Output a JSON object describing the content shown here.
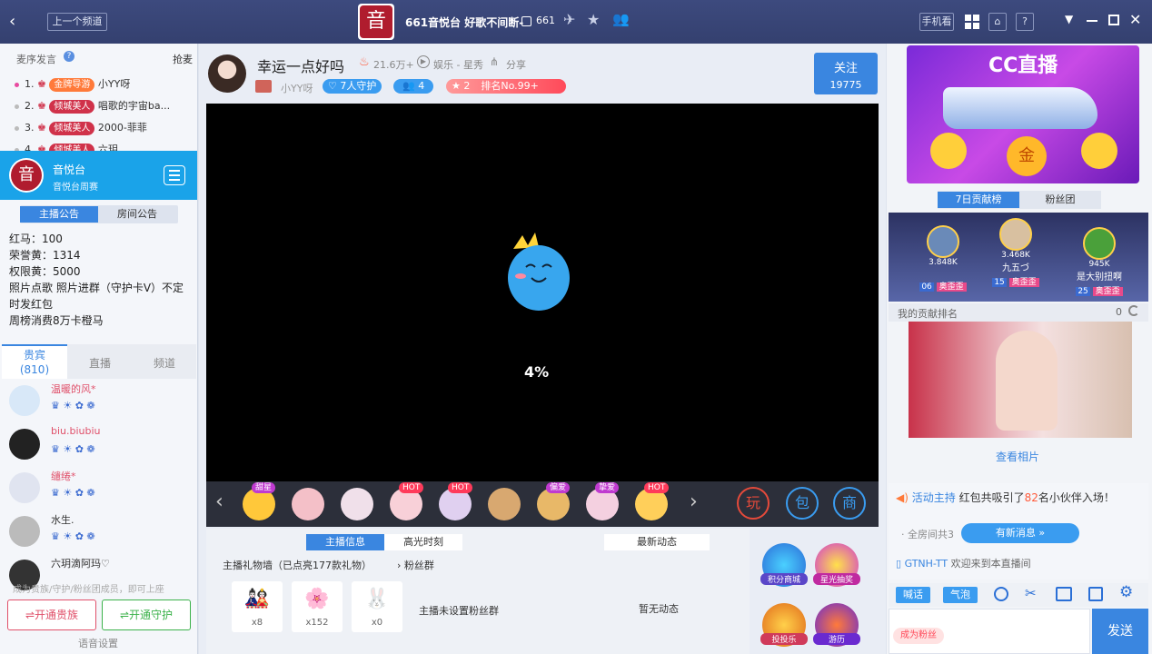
{
  "titlebar": {
    "back_icon": "chevron-left-icon",
    "prev_channel": "上一个频道",
    "logo_glyph": "音",
    "channel_name": "661音悦台 好歌不间断-",
    "channel_id": "661",
    "mobile_label": "手机看"
  },
  "left": {
    "rank_header": "麦序发言",
    "grab_label": "抢麦",
    "rank": [
      {
        "num": "1.",
        "tag": "金牌导游",
        "name": "小YY呀"
      },
      {
        "num": "2.",
        "tag": "倾城美人",
        "name": "唱歌的宇宙ba..."
      },
      {
        "num": "3.",
        "tag": "倾城美人",
        "name": "2000-菲菲"
      },
      {
        "num": "4.",
        "tag": "倾城美人",
        "name": "六玥"
      }
    ],
    "channel_logo": "音",
    "channel_title": "音悦台",
    "channel_sub": "音悦台周赛",
    "tabs": [
      "主播公告",
      "房间公告"
    ],
    "notice": [
      "红马：100",
      "荣誉黄：1314",
      "权限黄：5000",
      "照片点歌  照片进群（守护卡V）不定时发红包",
      "周榜消费8万卡橙马"
    ],
    "user_tabs": [
      "贵宾",
      "直播",
      "频道"
    ],
    "vip_count": "(810)",
    "users": [
      {
        "name": "温暖的风*",
        "color": "#e0506a"
      },
      {
        "name": "biu.biubiu",
        "color": "#e0506a"
      },
      {
        "name": "缱绻*",
        "color": "#e0506a"
      },
      {
        "name": "水生.",
        "color": "#333"
      },
      {
        "name": "六玥滴阿玛♡",
        "color": "#333"
      }
    ],
    "footer_hint": "成为贵族/守护/粉丝团成员，即可上座",
    "btn_noble": "开通贵族",
    "btn_guard": "开通守护",
    "voice_settings": "语音设置"
  },
  "anchor": {
    "name": "幸运一点好吗",
    "heat": "21.6万+",
    "category": "娱乐 - 星秀",
    "share": "分享",
    "sub_name": "小YY呀",
    "guards": "7人守护",
    "fans": "4",
    "rank_num": "2",
    "rank_label": "排名No.99+",
    "follow": "关注",
    "follow_count": "19775"
  },
  "video": {
    "progress": "4%",
    "progress_value": 0.04
  },
  "gifts": {
    "badges": [
      "甜星",
      "",
      "",
      "HOT",
      "HOT",
      "",
      "偏爱",
      "挚爱",
      "HOT"
    ],
    "tools": [
      "玩",
      "包",
      "商"
    ]
  },
  "bottom": {
    "tabs": [
      "主播信息",
      "高光时刻"
    ],
    "news_tab": "最新动态",
    "gift_wall": "主播礼物墙（已点亮177款礼物）",
    "fans_group": "粉丝群",
    "counts": [
      "x8",
      "x152",
      "x0"
    ],
    "no_fans": "主播未设置粉丝群",
    "no_news": "暂无动态",
    "features": [
      "积分商城",
      "星光抽奖",
      "投投乐",
      "游历"
    ]
  },
  "right": {
    "banner_logo": "CC直播",
    "tabs": [
      "7日贡献榜",
      "粉丝团"
    ],
    "top3": [
      {
        "score": "3.848K",
        "name": "",
        "lv": "06",
        "tag": "奥歪歪"
      },
      {
        "score": "3.468K",
        "name": "九五づ",
        "lv": "15",
        "tag": "奥歪歪"
      },
      {
        "score": "945K",
        "name": "是大别扭啊",
        "lv": "25",
        "tag": "奥歪歪"
      }
    ],
    "my_rank": "我的贡献排名",
    "my_rank_val": "0",
    "view_photos": "查看相片",
    "chat": [
      {
        "prefix": "活动主持",
        "text": " 红包共吸引了",
        "num": "82",
        "suffix": "名小伙伴入场！"
      },
      {
        "text": "全房间共3"
      }
    ],
    "new_msg": "有新消息",
    "welcome_user": "GTNH-TT",
    "welcome_text": "欢迎来到本直播间",
    "btn_shout": "喊话",
    "btn_bubble": "气泡",
    "become_fan": "成为粉丝",
    "send": "发送"
  }
}
